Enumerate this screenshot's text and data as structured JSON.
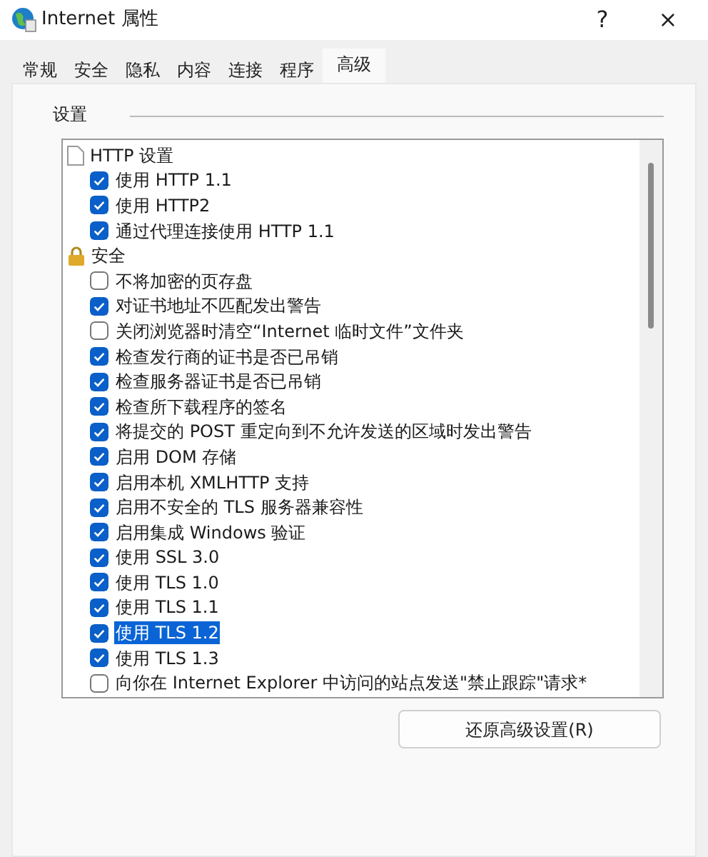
{
  "window": {
    "title": "Internet 属性",
    "help": "?",
    "close": "×"
  },
  "tabs": [
    {
      "label": "常规",
      "selected": false
    },
    {
      "label": "安全",
      "selected": false
    },
    {
      "label": "隐私",
      "selected": false
    },
    {
      "label": "内容",
      "selected": false
    },
    {
      "label": "连接",
      "selected": false
    },
    {
      "label": "程序",
      "selected": false
    },
    {
      "label": "高级",
      "selected": true
    }
  ],
  "settings": {
    "title": "设置",
    "groups": [
      {
        "label": "HTTP 设置",
        "children": [
          {
            "label": "使用 HTTP 1.1",
            "checked": true,
            "selected": false
          },
          {
            "label": "使用 HTTP2",
            "checked": true,
            "selected": false
          },
          {
            "label": "通过代理连接使用 HTTP 1.1",
            "checked": true,
            "selected": false
          }
        ]
      },
      {
        "label": "安全",
        "children": [
          {
            "label": "不将加密的页存盘",
            "checked": false,
            "selected": false
          },
          {
            "label": "对证书地址不匹配发出警告",
            "checked": true,
            "selected": false
          },
          {
            "label": "关闭浏览器时清空“Internet 临时文件”文件夹",
            "checked": false,
            "selected": false
          },
          {
            "label": "检查发行商的证书是否已吊销",
            "checked": true,
            "selected": false
          },
          {
            "label": "检查服务器证书是否已吊销",
            "checked": true,
            "selected": false
          },
          {
            "label": "检查所下载程序的签名",
            "checked": true,
            "selected": false
          },
          {
            "label": "将提交的 POST 重定向到不允许发送的区域时发出警告",
            "checked": true,
            "selected": false
          },
          {
            "label": "启用 DOM 存储",
            "checked": true,
            "selected": false
          },
          {
            "label": "启用本机 XMLHTTP 支持",
            "checked": true,
            "selected": false
          },
          {
            "label": "启用不安全的 TLS 服务器兼容性",
            "checked": true,
            "selected": false
          },
          {
            "label": "启用集成 Windows 验证",
            "checked": true,
            "selected": false
          },
          {
            "label": "使用 SSL 3.0",
            "checked": true,
            "selected": false
          },
          {
            "label": "使用 TLS 1.0",
            "checked": true,
            "selected": false
          },
          {
            "label": "使用 TLS 1.1",
            "checked": true,
            "selected": false
          },
          {
            "label": "使用 TLS 1.2",
            "checked": true,
            "selected": true
          },
          {
            "label": "使用 TLS 1.3",
            "checked": true,
            "selected": false
          },
          {
            "label": "向你在 Internet Explorer 中访问的站点发送\"禁止跟踪\"请求*",
            "checked": false,
            "selected": false
          }
        ]
      }
    ]
  },
  "buttons": [
    {
      "label": "还原高级设置(R)"
    }
  ]
}
